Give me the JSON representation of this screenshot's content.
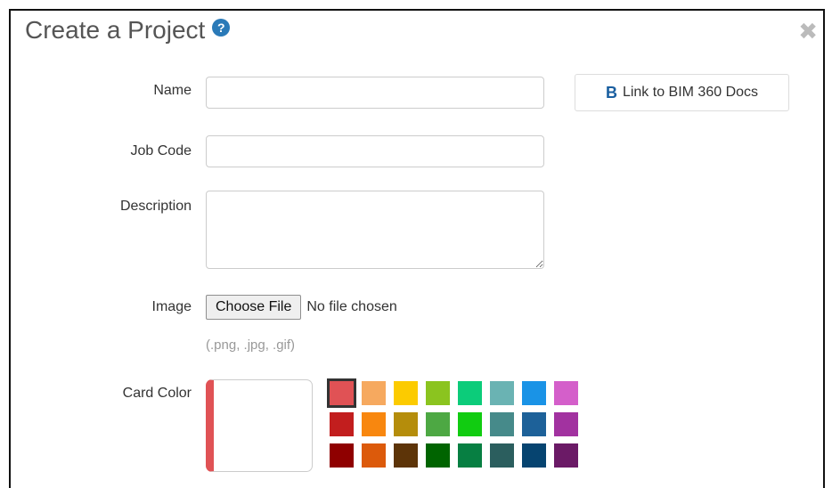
{
  "dialog": {
    "title": "Create a Project",
    "help_icon": "question-circle-icon",
    "close_icon": "close-icon",
    "close_glyph": "✖"
  },
  "form": {
    "name_label": "Name",
    "name_value": "",
    "job_code_label": "Job Code",
    "job_code_value": "",
    "description_label": "Description",
    "description_value": "",
    "image_label": "Image",
    "file_button_label": "Choose File",
    "file_status": "No file chosen",
    "file_hint": "(.png, .jpg, .gif)",
    "card_color_label": "Card Color"
  },
  "bim_link": {
    "icon_text": "B",
    "label": "Link to BIM 360 Docs"
  },
  "card_color": {
    "selected": "#e05255",
    "swatches": [
      "#e05255",
      "#f6a95f",
      "#fccb00",
      "#8bc41f",
      "#0ccc7a",
      "#6ab3b3",
      "#1a93e6",
      "#d45fca",
      "#c21e1e",
      "#f8870f",
      "#b58d0b",
      "#4da843",
      "#11cc11",
      "#468a8a",
      "#1d6199",
      "#a232a0",
      "#8f0000",
      "#dc5a0b",
      "#5d3408",
      "#006400",
      "#077f42",
      "#2b5e5e",
      "#064470",
      "#6b1a66"
    ]
  }
}
